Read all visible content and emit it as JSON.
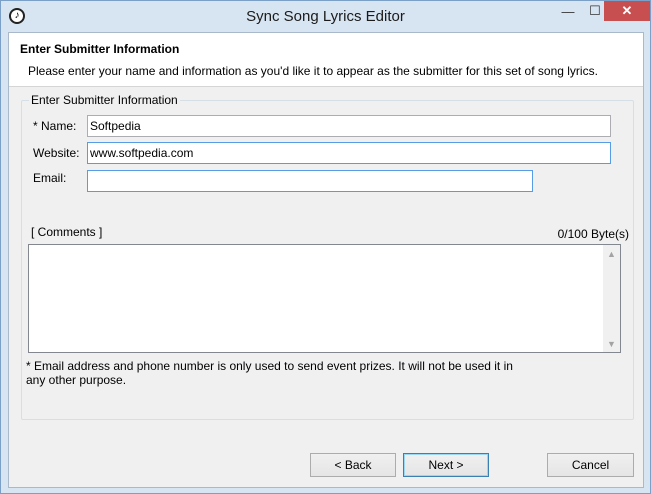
{
  "window": {
    "title": "Sync Song Lyrics Editor",
    "min_glyph": "—",
    "max_glyph": "☐",
    "close_glyph": "✕"
  },
  "header": {
    "title": "Enter Submitter Information",
    "description": "Please enter your name and information as you'd like it to appear as the submitter for this set of song lyrics."
  },
  "group": {
    "legend": "Enter Submitter Information",
    "name_label": "* Name:",
    "name_value": "Softpedia",
    "website_label": "Website:",
    "website_value": "www.softpedia.com",
    "email_label": "Email:",
    "email_value": "",
    "comments_label": "[ Comments ]",
    "byte_counter": "0/100 Byte(s)",
    "comments_value": "",
    "note": "* Email address and phone number is only used to send event prizes. It will not be used it in any other purpose."
  },
  "buttons": {
    "back": "< Back",
    "next": "Next >",
    "cancel": "Cancel"
  }
}
